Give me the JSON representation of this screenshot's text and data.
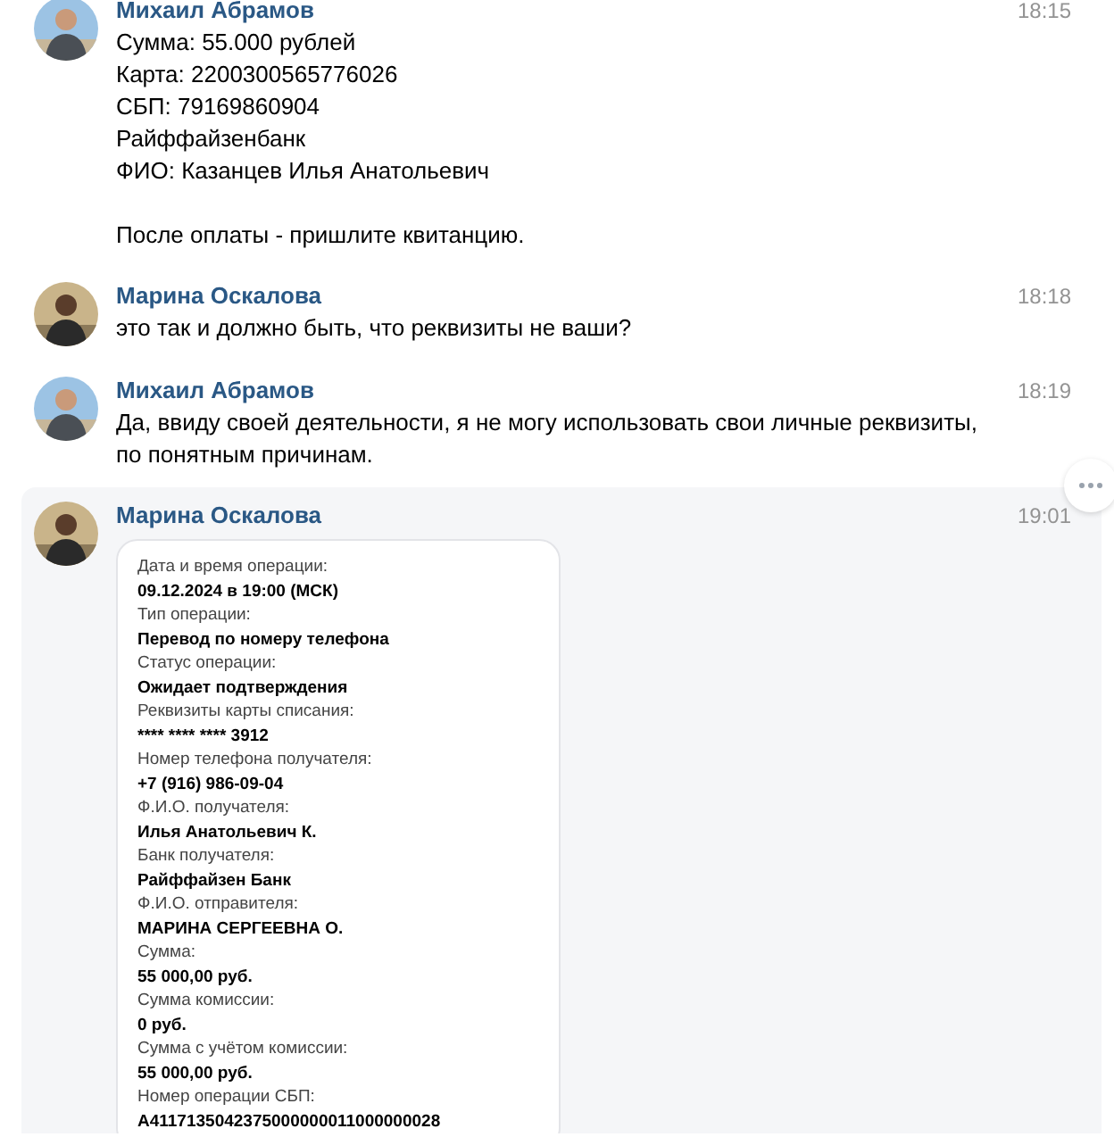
{
  "messages": [
    {
      "author": "Михаил Абрамов",
      "time": "18:15",
      "paragraphs": [
        [
          "Сумма: 55.000 рублей",
          "Карта: 2200300565776026",
          "СБП: 79169860904",
          "Райффайзенбанк",
          "ФИО: Казанцев Илья Анатольевич"
        ],
        [
          "После оплаты - пришлите квитанцию."
        ]
      ]
    },
    {
      "author": "Марина Оскалова",
      "time": "18:18",
      "paragraphs": [
        [
          "это так и должно быть, что реквизиты не ваши?"
        ]
      ]
    },
    {
      "author": "Михаил Абрамов",
      "time": "18:19",
      "paragraphs": [
        [
          "Да, ввиду своей деятельности, я не могу использовать свои личные реквизиты,",
          "по понятным причинам."
        ]
      ]
    },
    {
      "author": "Марина Оскалова",
      "time": "19:01",
      "highlighted": true,
      "attachment": {
        "kind": "receipt",
        "fields": [
          {
            "label": "Дата и время операции:",
            "value": "09.12.2024 в 19:00 (МСК)"
          },
          {
            "label": "Тип операции:",
            "value": "Перевод по номеру телефона"
          },
          {
            "label": "Статус операции:",
            "value": "Ожидает подтверждения"
          },
          {
            "label": "Реквизиты карты списания:",
            "value": "****  ****  ****  3912"
          },
          {
            "label": "Номер телефона получателя:",
            "value": "+7 (916) 986-09-04"
          },
          {
            "label": "Ф.И.О. получателя:",
            "value": "Илья Анатольевич К."
          },
          {
            "label": "Банк получателя:",
            "value": "Райффайзен Банк"
          },
          {
            "label": "Ф.И.О. отправителя:",
            "value": "МАРИНА СЕРГЕЕВНА О."
          },
          {
            "label": "Сумма:",
            "value": "55 000,00 руб."
          },
          {
            "label": "Сумма комиссии:",
            "value": "0 руб."
          },
          {
            "label": "Сумма с учётом комиссии:",
            "value": "55 000,00 руб."
          },
          {
            "label": "Номер операции СБП:",
            "value": "A4117135042375000000011000000028"
          }
        ]
      }
    }
  ]
}
